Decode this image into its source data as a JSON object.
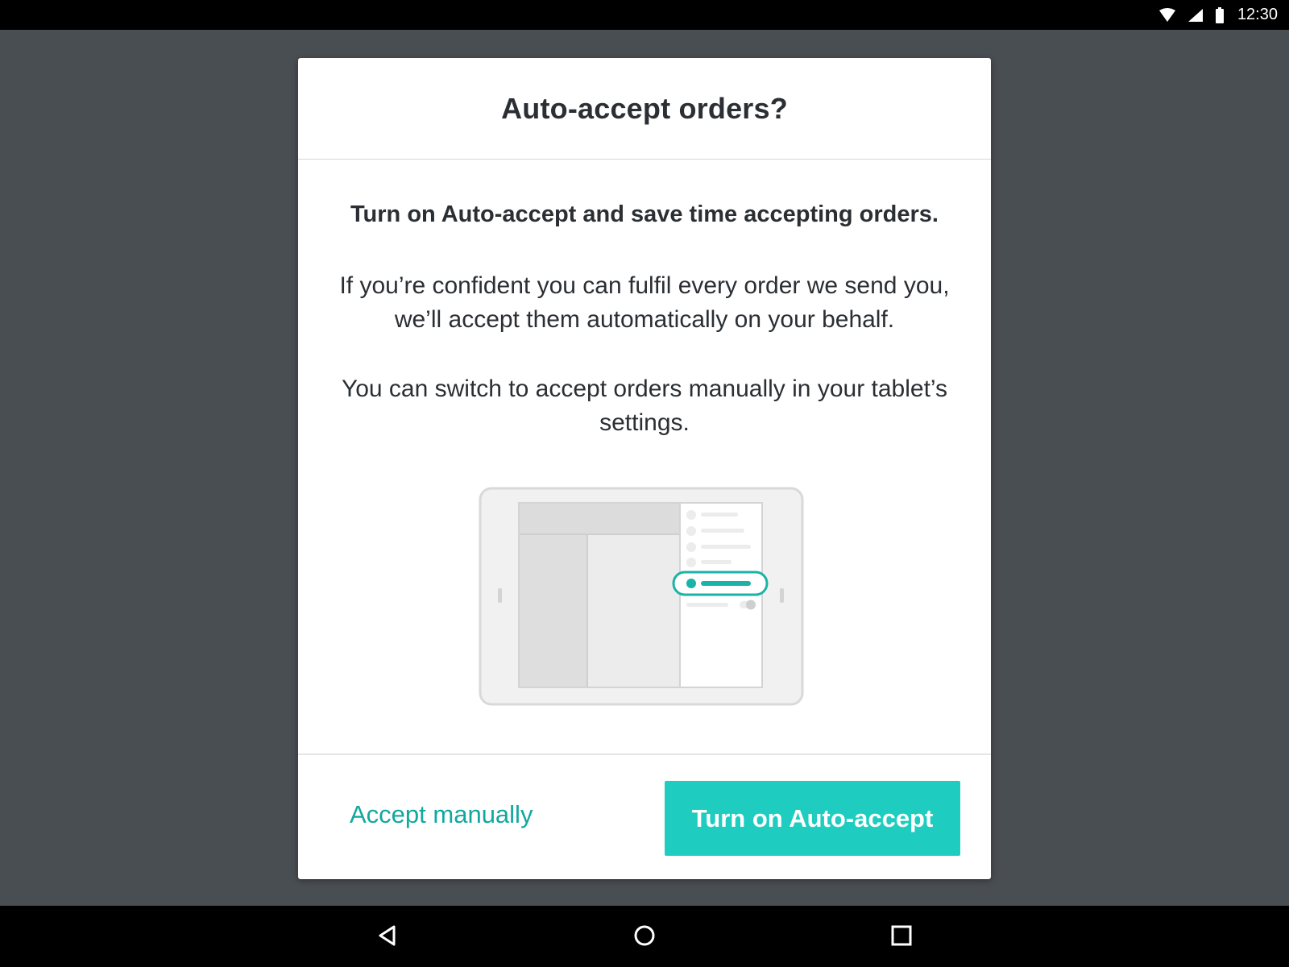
{
  "status_bar": {
    "time": "12:30",
    "icons": [
      "wifi-icon",
      "cellular-signal-icon",
      "battery-icon"
    ]
  },
  "dialog": {
    "title": "Auto-accept orders?",
    "lead": "Turn on Auto-accept and save time accepting orders.",
    "paragraph_1": "If you’re confident you can fulfil every order we send you, we’ll accept them automatically on your behalf.",
    "paragraph_2": "You can switch to accept orders manually in your tablet’s settings.",
    "illustration": "tablet-settings-illustration",
    "secondary_action": "Accept manually",
    "primary_action": "Turn on Auto-accept"
  },
  "nav_bar": {
    "buttons": [
      "back-icon",
      "home-icon",
      "recent-apps-icon"
    ]
  },
  "colors": {
    "accent": "#1ecdbf",
    "accent_text": "#11a89d",
    "scrim": "#494e52",
    "text": "#2b2f33"
  }
}
